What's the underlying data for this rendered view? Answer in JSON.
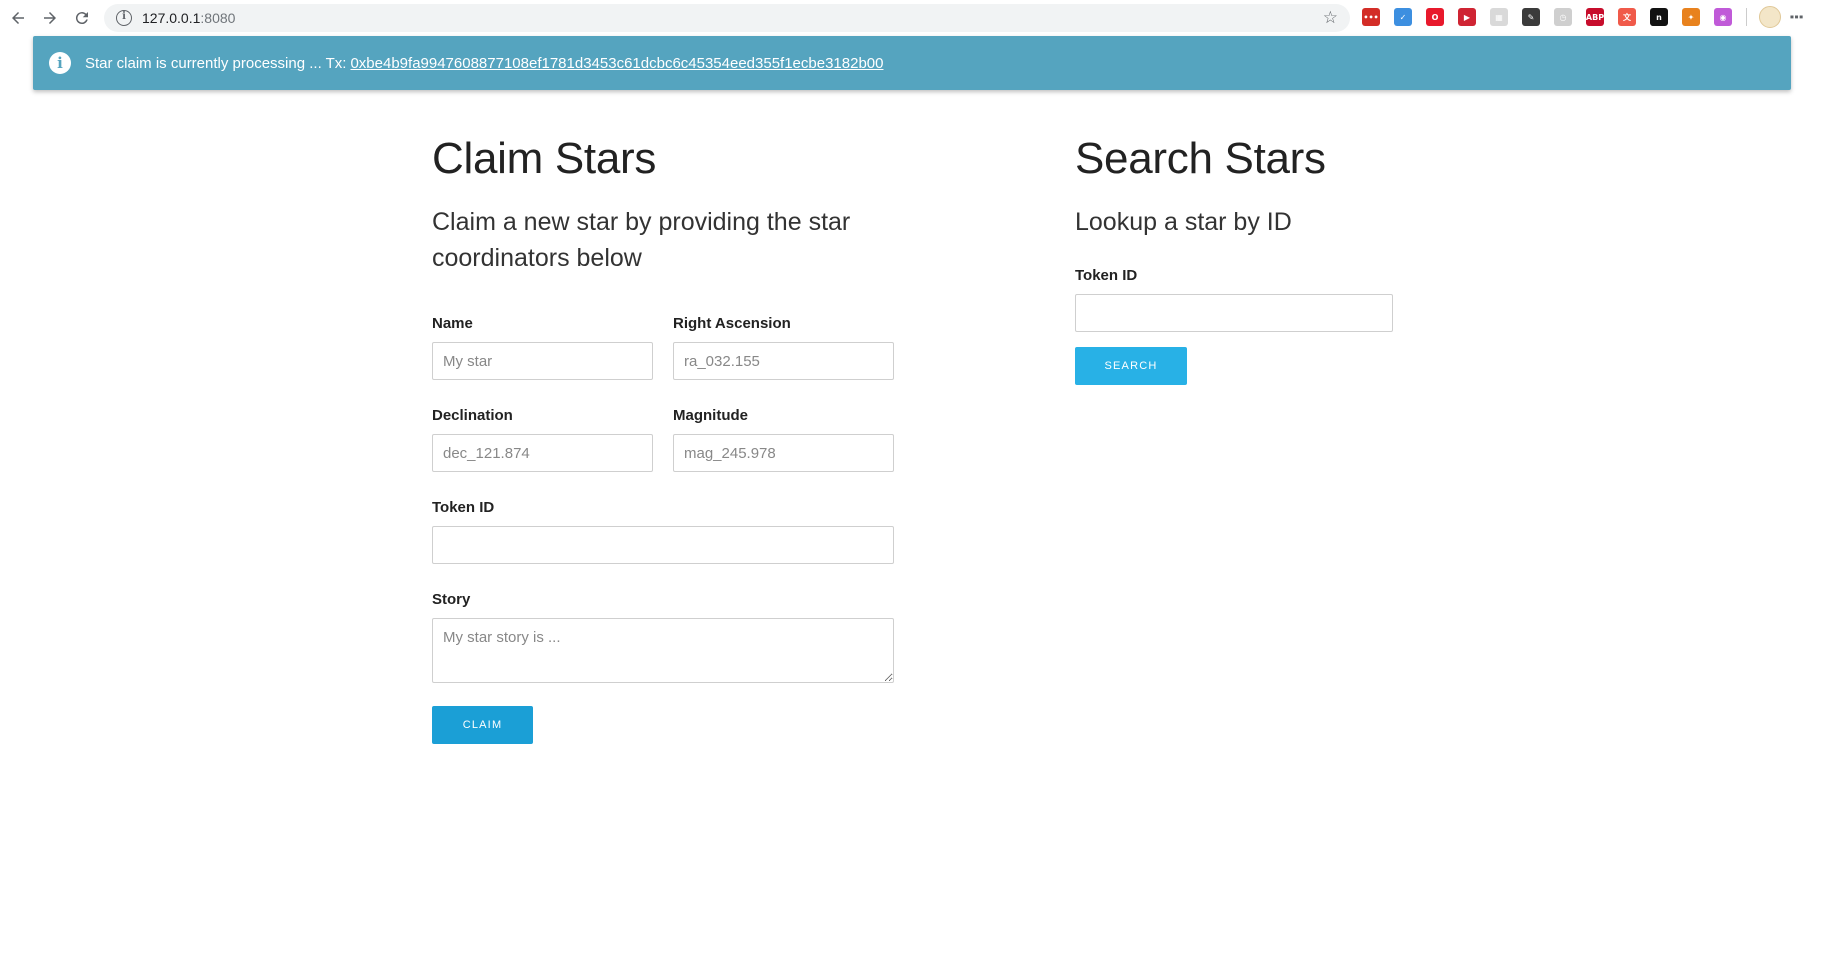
{
  "browser": {
    "url_host": "127.0.0.1",
    "url_port": ":8080",
    "extensions": [
      {
        "name": "lastpass-icon",
        "color": "#d32d27",
        "glyph": "•••"
      },
      {
        "name": "checkmark-extension-icon",
        "color": "#3d8fe0",
        "glyph": "✓"
      },
      {
        "name": "opera-icon",
        "color": "#e8192c",
        "glyph": "O"
      },
      {
        "name": "video-extension-icon",
        "color": "#cf2433",
        "glyph": "▶"
      },
      {
        "name": "grid-extension-icon",
        "color": "#d9d9d9",
        "glyph": "▦"
      },
      {
        "name": "pen-extension-icon",
        "color": "#3b3b3b",
        "glyph": "✎"
      },
      {
        "name": "clock-extension-icon",
        "color": "#cfcfcf",
        "glyph": "◷"
      },
      {
        "name": "adblock-plus-icon",
        "color": "#c70d2c",
        "glyph": "ABP"
      },
      {
        "name": "translate-extension-icon",
        "color": "#f05a4a",
        "glyph": "文"
      },
      {
        "name": "notion-extension-icon",
        "color": "#121212",
        "glyph": "n"
      },
      {
        "name": "metamask-icon",
        "color": "#e8821e",
        "glyph": "✦"
      },
      {
        "name": "color-extension-icon",
        "color": "#c05ad8",
        "glyph": "◉"
      }
    ]
  },
  "alert": {
    "message": "Star claim is currently processing ... Tx:",
    "tx_hash": "0xbe4b9fa9947608877108ef1781d3453c61dcbc6c45354eed355f1ecbe3182b00"
  },
  "claim": {
    "title": "Claim Stars",
    "subtitle": "Claim a new star by providing the star coordinators below",
    "name_label": "Name",
    "name_placeholder": "My star",
    "ra_label": "Right Ascension",
    "ra_placeholder": "ra_032.155",
    "dec_label": "Declination",
    "dec_placeholder": "dec_121.874",
    "mag_label": "Magnitude",
    "mag_placeholder": "mag_245.978",
    "token_label": "Token ID",
    "token_value": "",
    "story_label": "Story",
    "story_placeholder": "My star story is ...",
    "button_label": "Claim"
  },
  "search": {
    "title": "Search Stars",
    "subtitle": "Lookup a star by ID",
    "token_label": "Token ID",
    "token_value": "",
    "button_label": "Search"
  },
  "colors": {
    "alert_bg": "#55a4bf",
    "claim_button": "#1b9fd6",
    "search_button": "#28b1e6"
  }
}
